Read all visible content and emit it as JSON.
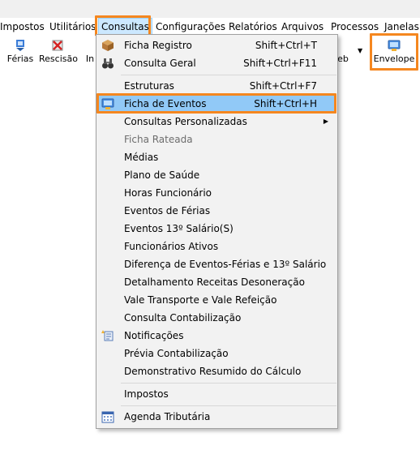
{
  "menubar": {
    "items": [
      {
        "label": "Impostos"
      },
      {
        "label": "Utilitários"
      },
      {
        "label": "Consultas"
      },
      {
        "label": "Configurações"
      },
      {
        "label": "Relatórios"
      },
      {
        "label": "Arquivos"
      },
      {
        "label": "Processos"
      },
      {
        "label": "Janelas"
      }
    ]
  },
  "toolbar": {
    "ferias_label": "Férias",
    "rescisao_label": "Rescisão",
    "partial_label": "In",
    "web_partial_label": "eb",
    "envelope_label": "Envelope"
  },
  "menu": {
    "items": [
      {
        "label": "Ficha Registro",
        "shortcut": "Shift+Ctrl+T",
        "icon": "box-icon"
      },
      {
        "label": "Consulta Geral",
        "shortcut": "Shift+Ctrl+F11",
        "icon": "binoculars-icon"
      },
      {
        "label": "Estruturas",
        "shortcut": "Shift+Ctrl+F7"
      },
      {
        "label": "Ficha de Eventos",
        "shortcut": "Shift+Ctrl+H",
        "icon": "computer-icon"
      },
      {
        "label": "Consultas Personalizadas",
        "submenu": true
      },
      {
        "label": "Ficha Rateada",
        "disabled": true
      },
      {
        "label": "Médias"
      },
      {
        "label": "Plano de Saúde"
      },
      {
        "label": "Horas Funcionário"
      },
      {
        "label": "Eventos de Férias"
      },
      {
        "label": "Eventos 13º Salário(S)"
      },
      {
        "label": "Funcionários Ativos"
      },
      {
        "label": "Diferença de Eventos-Férias e 13º Salário"
      },
      {
        "label": "Detalhamento Receitas Desoneração"
      },
      {
        "label": "Vale Transporte e Vale Refeição"
      },
      {
        "label": "Consulta Contabilização"
      },
      {
        "label": "Notificações",
        "icon": "notification-icon"
      },
      {
        "label": "Prévia Contabilização"
      },
      {
        "label": "Demonstrativo Resumido do Cálculo"
      },
      {
        "label": "Impostos"
      },
      {
        "label": "Agenda Tributária",
        "icon": "calendar-icon"
      }
    ]
  },
  "colors": {
    "highlight_border": "#f5871f",
    "selected_bg": "#91c9f7",
    "menu_bg": "#f2f2f2"
  }
}
